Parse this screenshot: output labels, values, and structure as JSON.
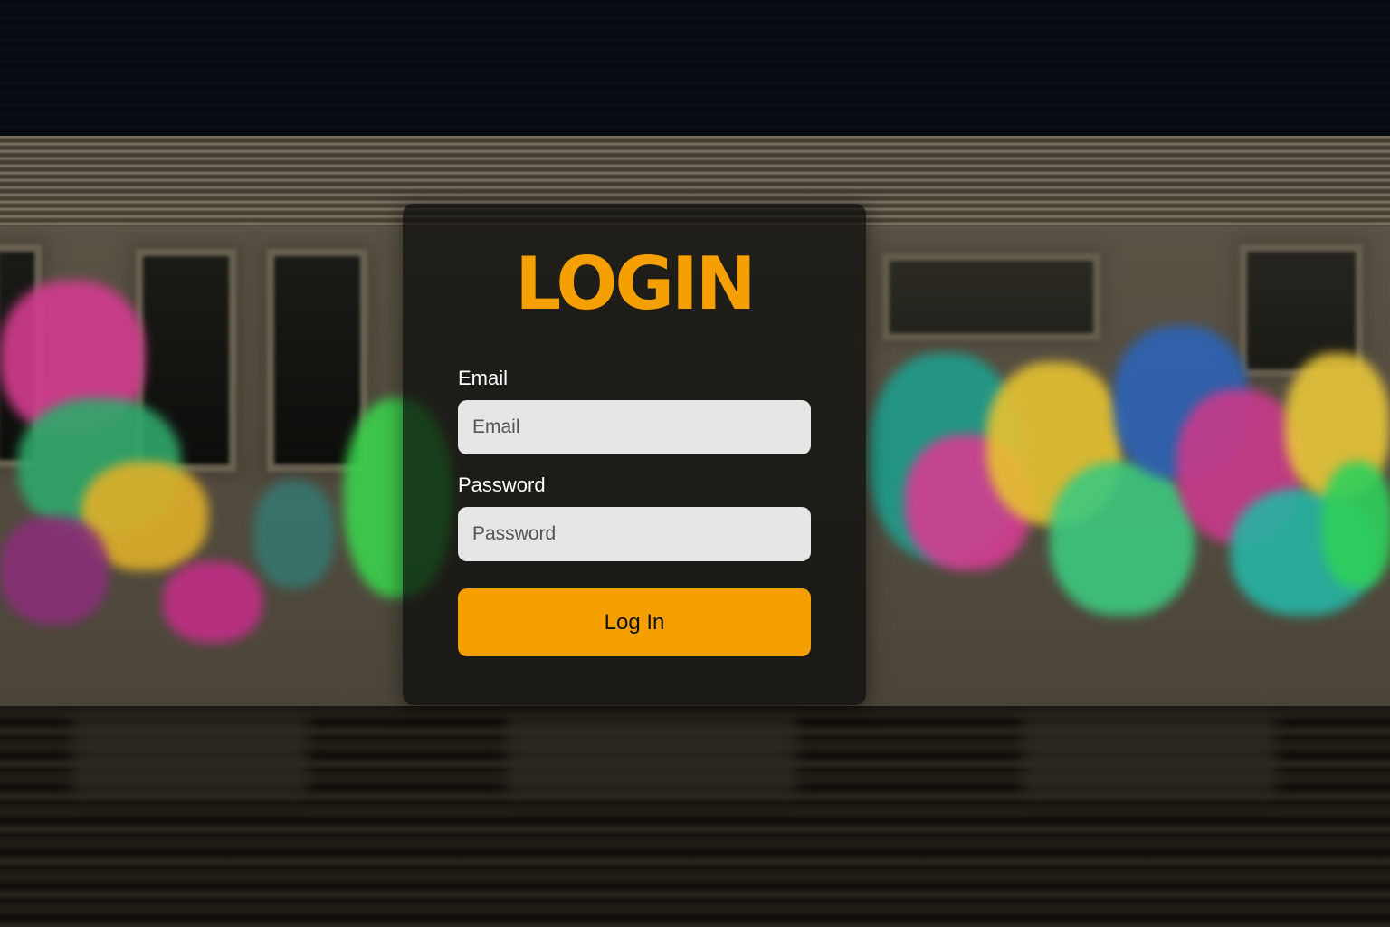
{
  "login": {
    "title": "LOGIN",
    "email_label": "Email",
    "email_placeholder": "Email",
    "email_value": "",
    "password_label": "Password",
    "password_placeholder": "Password",
    "password_value": "",
    "submit_label": "Log In"
  },
  "colors": {
    "accent": "#f5a000",
    "field_bg": "#e6e6e6",
    "card_bg": "rgba(10,10,8,0.72)",
    "label_text": "#ffffff"
  },
  "background": {
    "description_icon": "graffiti-train-background"
  }
}
